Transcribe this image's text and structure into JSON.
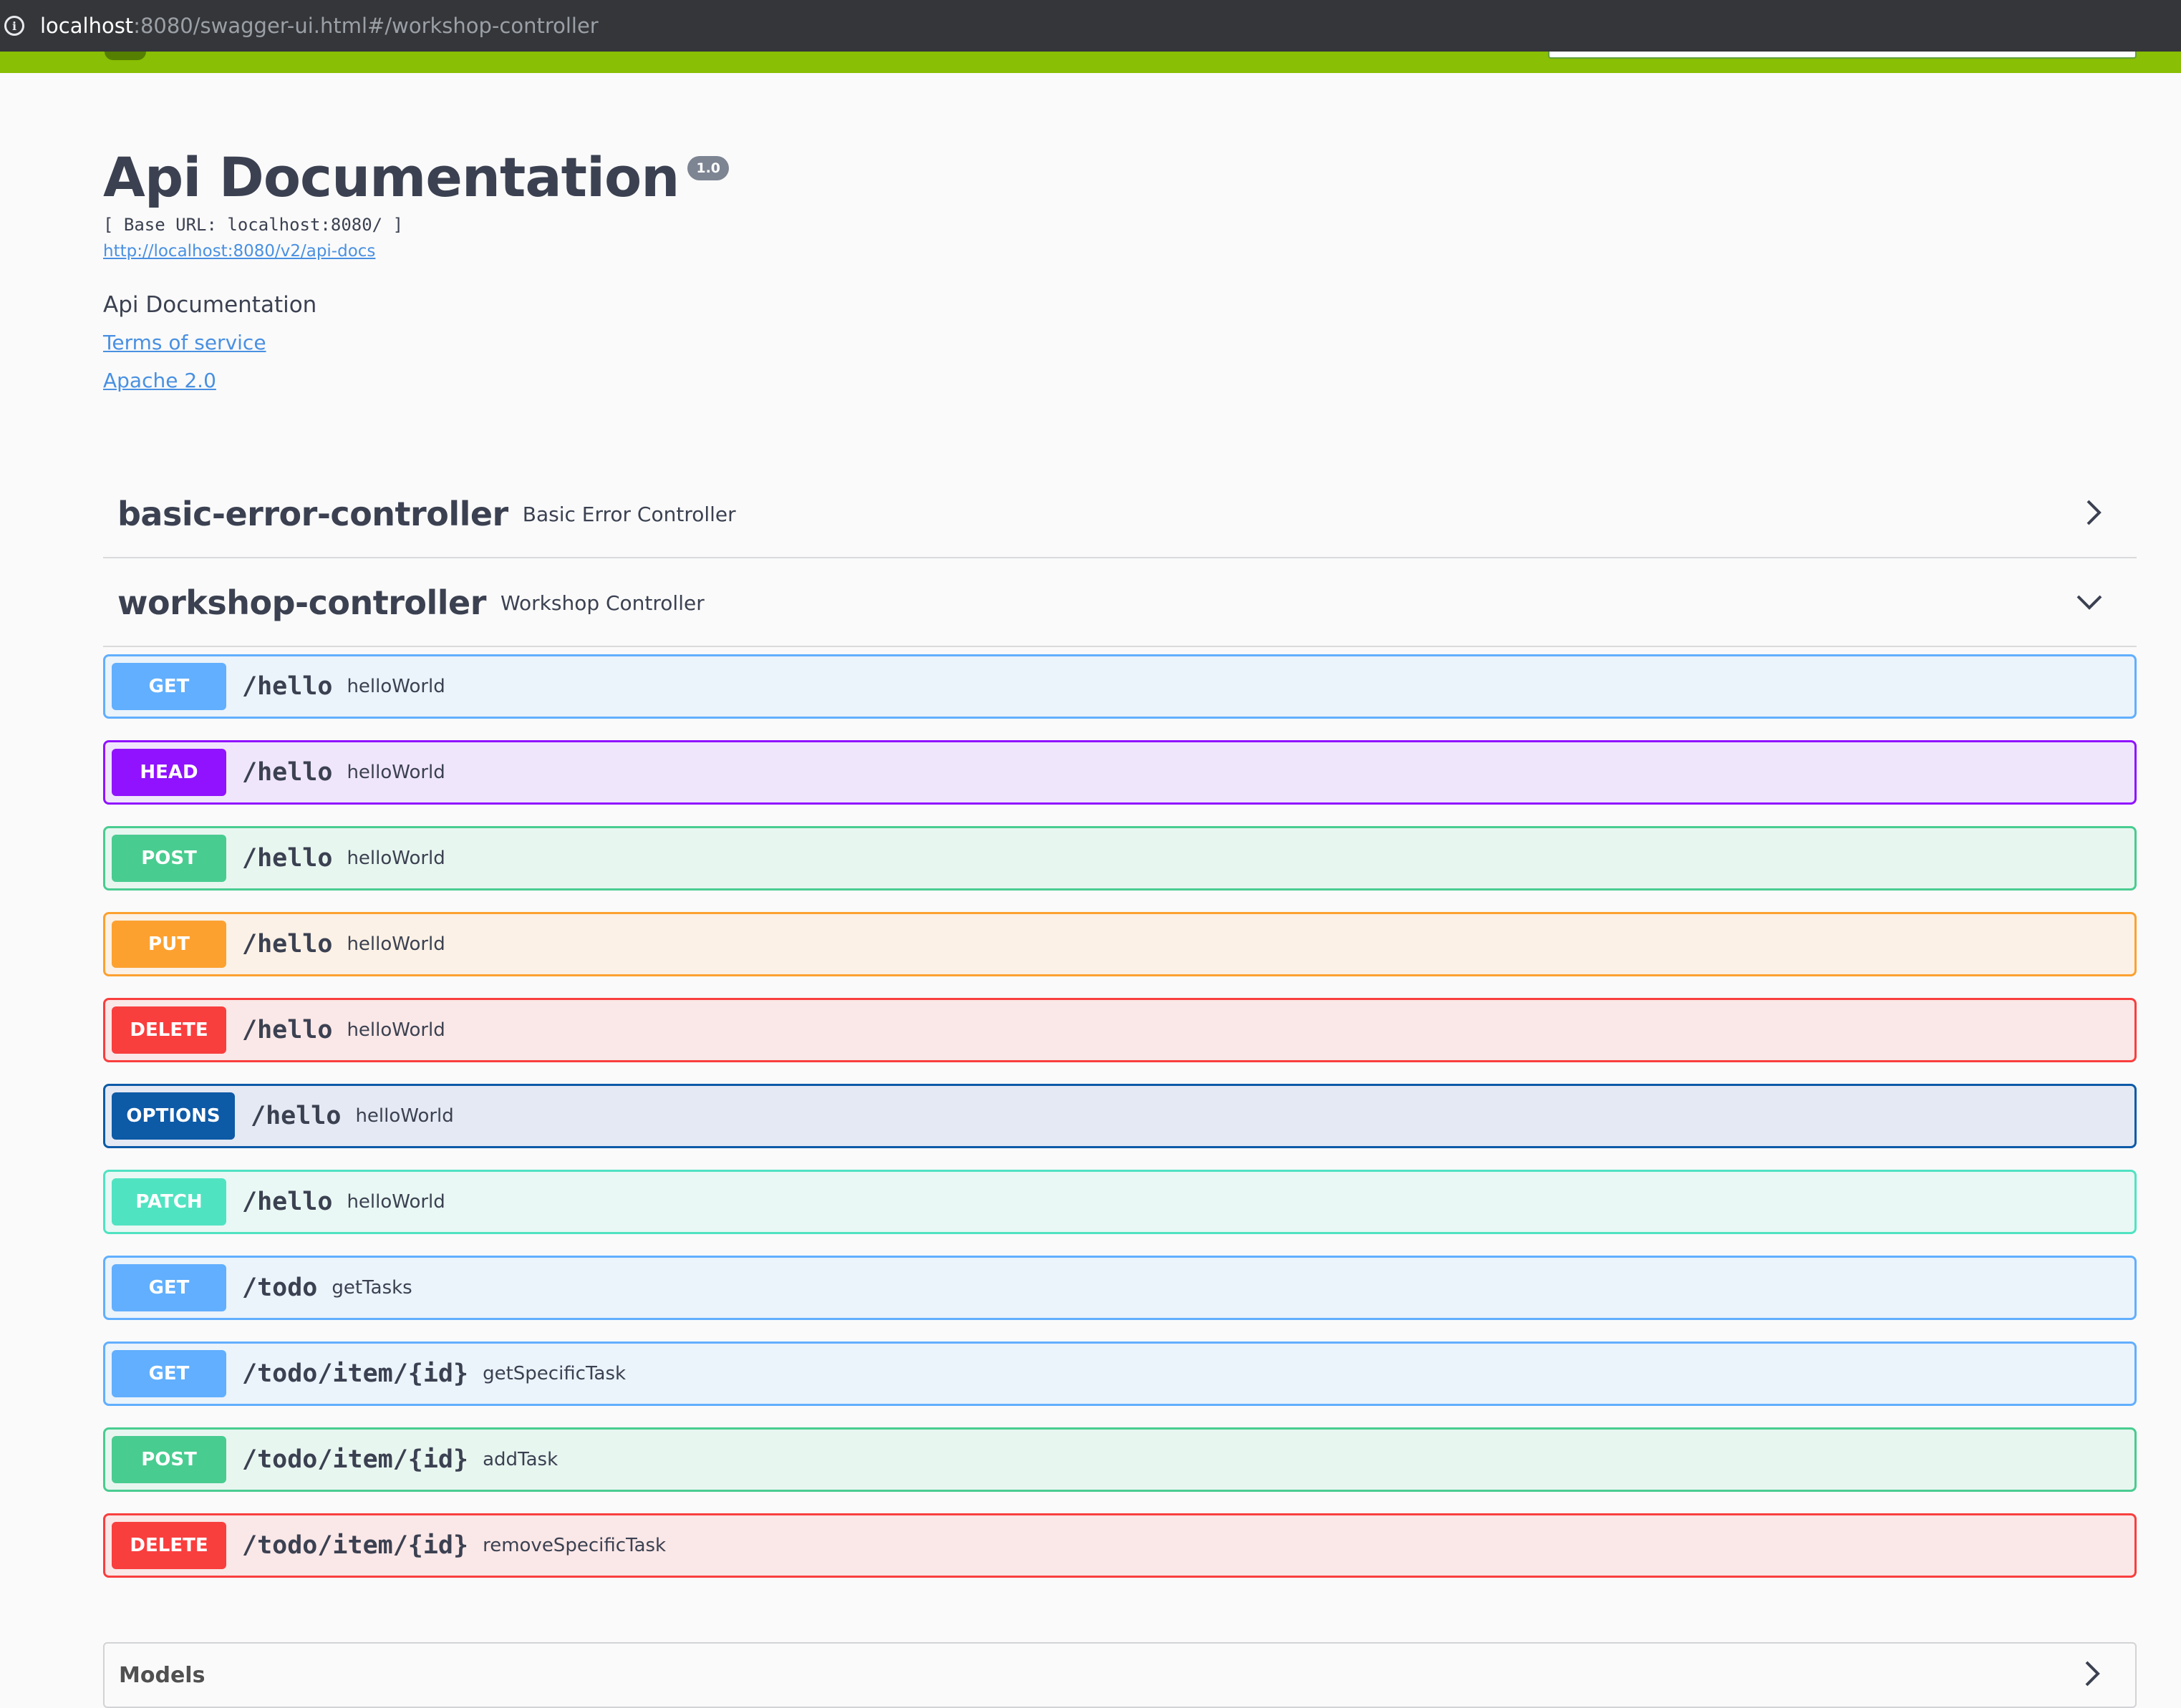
{
  "browser": {
    "url_host": "localhost",
    "url_rest": ":8080/swagger-ui.html#/workshop-controller"
  },
  "info": {
    "title": "Api Documentation",
    "version": "1.0",
    "base_url": "[ Base URL: localhost:8080/ ]",
    "spec_link": "http://localhost:8080/v2/api-docs",
    "description": "Api Documentation",
    "terms_link": "Terms of service",
    "license_link": "Apache 2.0"
  },
  "tags": [
    {
      "name": "basic-error-controller",
      "description": "Basic Error Controller",
      "expanded": false
    },
    {
      "name": "workshop-controller",
      "description": "Workshop Controller",
      "expanded": true
    }
  ],
  "operations": [
    {
      "method": "GET",
      "path": "/hello",
      "summary": "helloWorld"
    },
    {
      "method": "HEAD",
      "path": "/hello",
      "summary": "helloWorld"
    },
    {
      "method": "POST",
      "path": "/hello",
      "summary": "helloWorld"
    },
    {
      "method": "PUT",
      "path": "/hello",
      "summary": "helloWorld"
    },
    {
      "method": "DELETE",
      "path": "/hello",
      "summary": "helloWorld"
    },
    {
      "method": "OPTIONS",
      "path": "/hello",
      "summary": "helloWorld"
    },
    {
      "method": "PATCH",
      "path": "/hello",
      "summary": "helloWorld"
    },
    {
      "method": "GET",
      "path": "/todo",
      "summary": "getTasks"
    },
    {
      "method": "GET",
      "path": "/todo/item/{id}",
      "summary": "getSpecificTask"
    },
    {
      "method": "POST",
      "path": "/todo/item/{id}",
      "summary": "addTask"
    },
    {
      "method": "DELETE",
      "path": "/todo/item/{id}",
      "summary": "removeSpecificTask"
    }
  ],
  "models": {
    "title": "Models"
  },
  "icons": {
    "info": "info-icon",
    "collapsed": "chevron-right-icon",
    "expanded": "chevron-down-icon"
  },
  "colors": {
    "GET": "#61affe",
    "HEAD": "#9012fe",
    "POST": "#49cc90",
    "PUT": "#fca130",
    "DELETE": "#f93e3e",
    "OPTIONS": "#0d5aa7",
    "PATCH": "#50e3c2",
    "topbar": "#89bf04",
    "link": "#4990e2"
  }
}
